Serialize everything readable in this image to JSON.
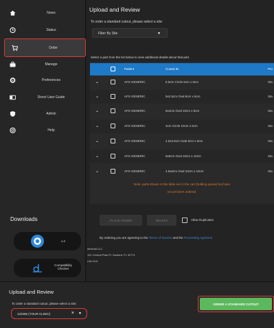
{
  "sidebar": {
    "items": [
      {
        "label": "News",
        "icon": "home-icon"
      },
      {
        "label": "Status",
        "icon": "clock-icon"
      },
      {
        "label": "Order",
        "icon": "cart-icon"
      },
      {
        "label": "Manage",
        "icon": "briefcase-icon"
      },
      {
        "label": "Preferences",
        "icon": "gear-icon"
      },
      {
        "label": "Direct User Guide",
        "icon": "card-icon"
      },
      {
        "label": "Admin",
        "icon": "shield-icon"
      },
      {
        "label": "Help",
        "icon": "help-icon"
      }
    ],
    "active_index": 2,
    "downloads_title": "Downloads",
    "downloads": [
      {
        "label": "v.4",
        "icon": "app-logo-icon"
      },
      {
        "label": "Compatibility Checker",
        "icon": "checker-logo-icon"
      }
    ]
  },
  "main": {
    "title": "Upload and Review",
    "subtitle": "To order a standard cutout, please select a site:",
    "filter_placeholder": "Filter By Site",
    "instruction": "Select a part from the list below to view additional details about that part.",
    "table": {
      "columns": [
        "Patient",
        "Cutout ID",
        "Pro"
      ],
      "rows": [
        {
          "patient": "AFS GENERIC",
          "cutout": "6.5cm Circle 6cm x 6cm",
          "pro": "Sta"
        },
        {
          "patient": "AFS GENERIC",
          "cutout": "5x2.5cm Oval 6cm x 6cm",
          "pro": "Sta"
        },
        {
          "patient": "AFS GENERIC",
          "cutout": "6x4cm Oval 10cm x 6cm",
          "pro": "Sta"
        },
        {
          "patient": "AFS GENERIC",
          "cutout": "3cm Circle 10cm x 6cm",
          "pro": "Sta"
        },
        {
          "patient": "AFS GENERIC",
          "cutout": "4.5x3.5cm Oval 6cm x 6cm",
          "pro": "Sta"
        },
        {
          "patient": "AFS GENERIC",
          "cutout": "5x6cm Oval 10cm x 10cm",
          "pro": "Sta"
        },
        {
          "patient": "AFS GENERIC",
          "cutout": "4.5x6cm Oval 10cm x 10cm",
          "pro": "Sta"
        }
      ],
      "note_line1": "Note: parts shown in this table are in the cart (holding queue) but have",
      "note_line2": "not yet been ordered."
    },
    "place_order_label": "PLACE ORDER",
    "delete_label": "DELETE",
    "allow_duplicates_label": "Allow Duplicates",
    "terms_prefix": "By ordering you are agreeing to the",
    "terms_link": "Terms of Service",
    "terms_and": "and the",
    "privacy_link": "Processing Agreeme",
    "address_line1": "decimal LLC",
    "address_line2": "121 Central Park Pl, Sanford, FL 32771",
    "version": "v16.15.6"
  },
  "bottom": {
    "title": "Upload and Review",
    "subtitle": "To order a standard cutout, please select a site:",
    "clinic_value": "123456 (YOUR CLINIC)",
    "order_button_label": "ORDER A STANDARD CUTOUT"
  },
  "colors": {
    "accent_blue": "#1e79c6",
    "highlight_red": "#e03a3a",
    "note_orange": "#e0782e",
    "order_green": "#5cb85c"
  }
}
